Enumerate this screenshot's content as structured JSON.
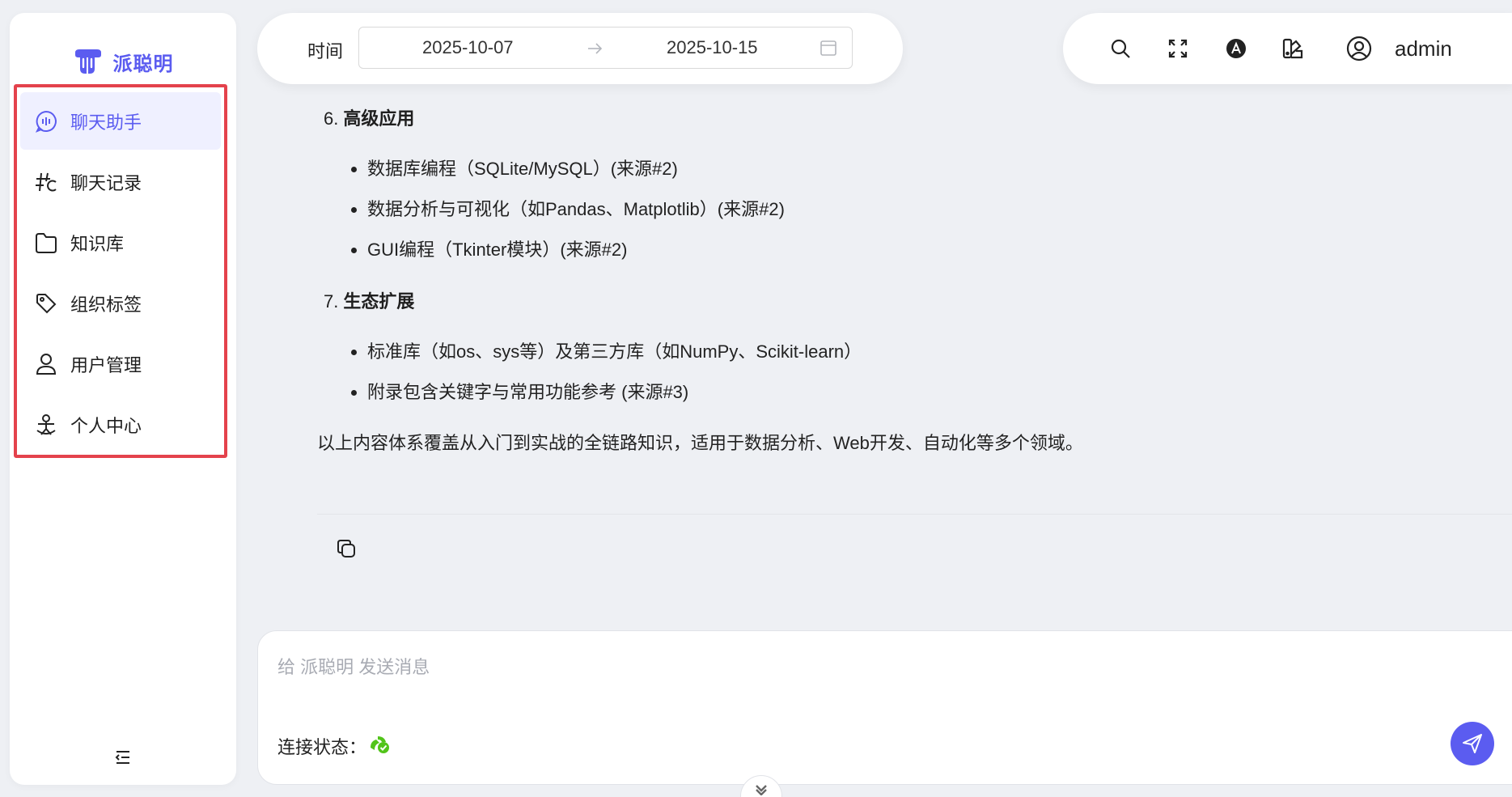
{
  "brand": {
    "name": "派聪明",
    "color": "#5b5cf0"
  },
  "sidebar": {
    "items": [
      {
        "label": "聊天助手",
        "icon": "chat-bubble-icon",
        "active": true
      },
      {
        "label": "聊天记录",
        "icon": "hash-history-icon",
        "active": false
      },
      {
        "label": "知识库",
        "icon": "folder-icon",
        "active": false
      },
      {
        "label": "组织标签",
        "icon": "tag-icon",
        "active": false
      },
      {
        "label": "用户管理",
        "icon": "user-icon",
        "active": false
      },
      {
        "label": "个人中心",
        "icon": "person-center-icon",
        "active": false
      }
    ]
  },
  "topbar": {
    "time_label": "时间",
    "date_start": "2025-10-07",
    "date_end": "2025-10-15",
    "user": "admin"
  },
  "content": {
    "sections": [
      {
        "num": "6.",
        "title": "高级应用",
        "items": [
          "数据库编程（SQLite/MySQL）(来源#2)",
          "数据分析与可视化（如Pandas、Matplotlib）(来源#2)",
          "GUI编程（Tkinter模块）(来源#2)"
        ]
      },
      {
        "num": "7.",
        "title": "生态扩展",
        "items": [
          "标准库（如os、sys等）及第三方库（如NumPy、Scikit-learn）",
          "附录包含关键字与常用功能参考 (来源#3)"
        ]
      }
    ],
    "summary": "以上内容体系覆盖从入门到实战的全链路知识，适用于数据分析、Web开发、自动化等多个领域。"
  },
  "input": {
    "placeholder": "给 派聪明 发送消息",
    "conn_label": "连接状态：",
    "conn_color": "#52c41a"
  }
}
